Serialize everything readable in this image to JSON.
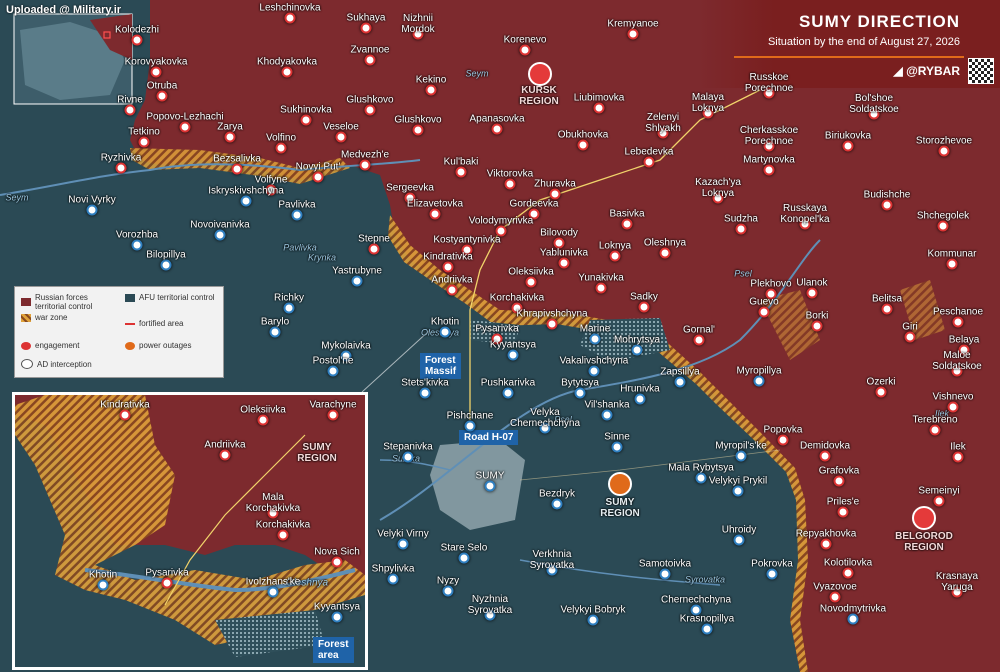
{
  "header": {
    "title": "SUMY DIRECTION",
    "subtitle": "Situation by the end of August 27, 2026",
    "brand": "◢ @RYBAR",
    "watermark": "Uploaded @ Military.ir"
  },
  "colors": {
    "russian": "#7d2a2e",
    "ukraine": "#2b4a55",
    "warzone": "#e0a23a",
    "accent": "#e06a1a",
    "river": "#5f8fb6"
  },
  "legend": {
    "russian_control": "Russian forces territorial control",
    "afu_control": "AFU territorial control",
    "war_zone": "war zone",
    "fortified_area": "fortified area",
    "engagement": "engagement",
    "power_outages": "power outages",
    "ad_interception": "AD interception"
  },
  "regions": {
    "kursk": "KURSK\nREGION",
    "sumy": "SUMY\nREGION",
    "belgorod": "BELGOROD\nREGION",
    "sumy_inset": "SUMY\nREGION"
  },
  "tags": {
    "forest_massif": "Forest\nMassif",
    "road": "Road H-07",
    "forest_area": "Forest\narea"
  },
  "rivers": {
    "seym1": "Seym",
    "seym2": "Seym",
    "pavlivka": "Pavlivka",
    "krynka": "Krynka",
    "psel1": "Psel",
    "psel2": "Psel",
    "sumka": "Sumka",
    "syrovatka": "Syrovatka",
    "ilek": "Ilek",
    "oleshnya": "Oleshnya",
    "oleshnya_inset": "Oleshnya"
  },
  "places": [
    {
      "id": "leshchinovka",
      "name": "Leshchinovka",
      "red": true
    },
    {
      "id": "sukhaya",
      "name": "Sukhaya",
      "red": true
    },
    {
      "id": "nizhnii",
      "name": "Nizhnii\nMordok",
      "red": true
    },
    {
      "id": "korenevo",
      "name": "Korenevo",
      "red": true
    },
    {
      "id": "kremyanoe",
      "name": "Kremyanoe",
      "red": true
    },
    {
      "id": "kolodezhi",
      "name": "Kolodezhi",
      "red": true
    },
    {
      "id": "zvannoe",
      "name": "Zvannoe",
      "red": true
    },
    {
      "id": "korovyakovka",
      "name": "Korovyakovka",
      "red": true
    },
    {
      "id": "khodyakovka",
      "name": "Khodyakovka",
      "red": true
    },
    {
      "id": "kekino",
      "name": "Kekino",
      "red": true
    },
    {
      "id": "russkoe",
      "name": "Russkoe\nPorechnoe",
      "red": true
    },
    {
      "id": "otruba",
      "name": "Otruba",
      "red": true
    },
    {
      "id": "glushkovo",
      "name": "Glushkovo",
      "red": true
    },
    {
      "id": "liubimovka",
      "name": "Liubimovka",
      "red": true
    },
    {
      "id": "malaya",
      "name": "Malaya\nLoknya",
      "red": true
    },
    {
      "id": "bolshoe",
      "name": "Bol'shoe\nSoldatskoe",
      "red": true
    },
    {
      "id": "rivne",
      "name": "Rivne",
      "red": true
    },
    {
      "id": "popovo",
      "name": "Popovo-Lezhachi",
      "red": true
    },
    {
      "id": "sukhinovka",
      "name": "Sukhinovka",
      "red": true
    },
    {
      "id": "apanasovka",
      "name": "Apanasovka",
      "red": true
    },
    {
      "id": "zelenyi",
      "name": "Zelenyi\nShlyakh",
      "red": true
    },
    {
      "id": "cherkasskoe",
      "name": "Cherkasskoe\nPorechnoe",
      "red": true
    },
    {
      "id": "biriukovka",
      "name": "Biriukovka",
      "red": true
    },
    {
      "id": "tetkino",
      "name": "Tetkino",
      "red": true
    },
    {
      "id": "zarya",
      "name": "Zarya",
      "red": true
    },
    {
      "id": "volfino",
      "name": "Volfino",
      "red": true
    },
    {
      "id": "veseloe",
      "name": "Veseloe",
      "red": true
    },
    {
      "id": "glushkovo2",
      "name": "Glushkovo",
      "red": true
    },
    {
      "id": "obukhovka",
      "name": "Obukhovka",
      "red": true
    },
    {
      "id": "storozhevoe",
      "name": "Storozhevoe",
      "red": true
    },
    {
      "id": "medvezhe",
      "name": "Medvezh'e",
      "red": true
    },
    {
      "id": "lebedevka",
      "name": "Lebedevka",
      "red": true
    },
    {
      "id": "martynovka",
      "name": "Martynovka",
      "red": true
    },
    {
      "id": "ryzhivka",
      "name": "Ryzhivka",
      "red": true
    },
    {
      "id": "bezsalivka",
      "name": "Bezsalivka",
      "red": true
    },
    {
      "id": "novyiput",
      "name": "Novyi Put'",
      "red": true
    },
    {
      "id": "kubaki",
      "name": "Kul'baki",
      "red": true
    },
    {
      "id": "volfyne",
      "name": "Volfyne",
      "red": true
    },
    {
      "id": "viktorovka",
      "name": "Viktorovka",
      "red": true
    },
    {
      "id": "kazachya",
      "name": "Kazach'ya\nLoknya",
      "red": true
    },
    {
      "id": "budishche",
      "name": "Budishche",
      "red": true
    },
    {
      "id": "iskryskivshchyna",
      "name": "Iskryskivshchyna",
      "red": false
    },
    {
      "id": "sergeevka",
      "name": "Sergeevka",
      "red": true
    },
    {
      "id": "zhuravka",
      "name": "Zhuravka",
      "red": true
    },
    {
      "id": "russkaya",
      "name": "Russkaya\nKonopel'ka",
      "red": true
    },
    {
      "id": "novivyrky",
      "name": "Novi Vyrky",
      "red": false
    },
    {
      "id": "pavlivka",
      "name": "Pavlivka",
      "red": false
    },
    {
      "id": "elizavetovka",
      "name": "Elizavetovka",
      "red": true
    },
    {
      "id": "gordeevka",
      "name": "Gordeevka",
      "red": true
    },
    {
      "id": "basivka",
      "name": "Basivka",
      "red": true
    },
    {
      "id": "sudzha",
      "name": "Sudzha",
      "red": true
    },
    {
      "id": "shchegolek",
      "name": "Shchegolek",
      "red": true
    },
    {
      "id": "vorozhba",
      "name": "Vorozhba",
      "red": false
    },
    {
      "id": "novoivanivka",
      "name": "Novoivanivka",
      "red": false
    },
    {
      "id": "volodymyrivka",
      "name": "Volodymyrivka",
      "red": true
    },
    {
      "id": "bilovody",
      "name": "Bilovody",
      "red": true
    },
    {
      "id": "stepne",
      "name": "Stepne",
      "red": true
    },
    {
      "id": "kostyantynivka",
      "name": "Kostyantynivka",
      "red": true
    },
    {
      "id": "oleshnya",
      "name": "Oleshnya",
      "red": true
    },
    {
      "id": "bilopillya",
      "name": "Bilopillya",
      "red": false
    },
    {
      "id": "yablunivka",
      "name": "Yablunivka",
      "red": true
    },
    {
      "id": "loknya",
      "name": "Loknya",
      "red": true
    },
    {
      "id": "kommunar",
      "name": "Kommunar",
      "red": true
    },
    {
      "id": "kindrativka",
      "name": "Kindrativka",
      "red": true
    },
    {
      "id": "yastrubyne",
      "name": "Yastrubyne",
      "red": false
    },
    {
      "id": "oleksiivka",
      "name": "Oleksiivka",
      "red": true
    },
    {
      "id": "yunakivka",
      "name": "Yunakivka",
      "red": true
    },
    {
      "id": "plekhovo",
      "name": "Plekhovo",
      "red": true
    },
    {
      "id": "ulanok",
      "name": "Ulanok",
      "red": true
    },
    {
      "id": "andriivka",
      "name": "Andriivka",
      "red": true
    },
    {
      "id": "korchakivka",
      "name": "Korchakivka",
      "red": true
    },
    {
      "id": "sadky",
      "name": "Sadky",
      "red": true
    },
    {
      "id": "guevo",
      "name": "Guevo",
      "red": true
    },
    {
      "id": "belitsa",
      "name": "Belitsa",
      "red": true
    },
    {
      "id": "richky",
      "name": "Richky",
      "red": false
    },
    {
      "id": "khrapivshchyna",
      "name": "Khrapivshchyna",
      "red": true
    },
    {
      "id": "borki",
      "name": "Borki",
      "red": true
    },
    {
      "id": "peschanoe",
      "name": "Peschanoe",
      "red": true
    },
    {
      "id": "barylo",
      "name": "Barylo",
      "red": false
    },
    {
      "id": "khotin",
      "name": "Khotin",
      "red": false
    },
    {
      "id": "pysarivka",
      "name": "Pysarivka",
      "red": true
    },
    {
      "id": "marine",
      "name": "Marine",
      "red": false
    },
    {
      "id": "gornal",
      "name": "Gornal'",
      "red": true
    },
    {
      "id": "giri",
      "name": "Giri",
      "red": true
    },
    {
      "id": "mykolaivka",
      "name": "Mykolaivka",
      "red": false
    },
    {
      "id": "kyyantsya",
      "name": "Kyyantsya",
      "red": false
    },
    {
      "id": "mohrytsya",
      "name": "Mohrytsya",
      "red": false
    },
    {
      "id": "belaya",
      "name": "Belaya",
      "red": true
    },
    {
      "id": "postolne",
      "name": "Postol'ne",
      "red": false
    },
    {
      "id": "vakalivshchyna",
      "name": "Vakalivshchyna",
      "red": false
    },
    {
      "id": "maloe",
      "name": "Maloe\nSoldatskoe",
      "red": true
    },
    {
      "id": "pushkarivka",
      "name": "Pushkarivka",
      "red": false
    },
    {
      "id": "bytytsya",
      "name": "Bytytsya",
      "red": false
    },
    {
      "id": "zapsillya",
      "name": "Zapsillya",
      "red": false
    },
    {
      "id": "myropillya",
      "name": "Myropillya",
      "red": false
    },
    {
      "id": "ozerki",
      "name": "Ozerki",
      "red": true
    },
    {
      "id": "stetskivka",
      "name": "Stets'kivka",
      "red": false
    },
    {
      "id": "hrunivka",
      "name": "Hrunivka",
      "red": false
    },
    {
      "id": "vishnevo",
      "name": "Vishnevo",
      "red": true
    },
    {
      "id": "pishchane",
      "name": "Pishchane",
      "red": false
    },
    {
      "id": "velyka",
      "name": "Velyka\nChernechchyna",
      "red": false
    },
    {
      "id": "vilshanka",
      "name": "Vil'shanka",
      "red": false
    },
    {
      "id": "popovka",
      "name": "Popovka",
      "red": true
    },
    {
      "id": "terebreno",
      "name": "Terebreno",
      "red": true
    },
    {
      "id": "stepanivka",
      "name": "Stepanivka",
      "red": false
    },
    {
      "id": "sinne",
      "name": "Sinne",
      "red": false
    },
    {
      "id": "myropilske",
      "name": "Myropil's'ke",
      "red": false
    },
    {
      "id": "demidovka",
      "name": "Demidovka",
      "red": true
    },
    {
      "id": "ilek",
      "name": "Ilek",
      "red": true
    },
    {
      "id": "sumy",
      "name": "SUMY",
      "red": false
    },
    {
      "id": "malarybytsya",
      "name": "Mala Rybytsya",
      "red": false
    },
    {
      "id": "velykyiprykil",
      "name": "Velykyi Prykil",
      "red": false
    },
    {
      "id": "grafovka",
      "name": "Grafovka",
      "red": true
    },
    {
      "id": "bezdryk",
      "name": "Bezdryk",
      "red": false
    },
    {
      "id": "prilese",
      "name": "Priles'e",
      "red": true
    },
    {
      "id": "semeinyi",
      "name": "Semeinyi",
      "red": true
    },
    {
      "id": "uhroidy",
      "name": "Uhroidy",
      "red": false
    },
    {
      "id": "velykivirny",
      "name": "Velyki Virny",
      "red": false
    },
    {
      "id": "repyakhovka",
      "name": "Repyakhovka",
      "red": true
    },
    {
      "id": "stareselo",
      "name": "Stare Selo",
      "red": false
    },
    {
      "id": "verkhnia",
      "name": "Verkhnia\nSyrovatka",
      "red": false
    },
    {
      "id": "samotoivka",
      "name": "Samotoivka",
      "red": false
    },
    {
      "id": "kolotilovka",
      "name": "Kolotilovka",
      "red": true
    },
    {
      "id": "shpylivka",
      "name": "Shpylivka",
      "red": false
    },
    {
      "id": "pokrovka",
      "name": "Pokrovka",
      "red": false
    },
    {
      "id": "vyazovoe",
      "name": "Vyazovoe",
      "red": true
    },
    {
      "id": "krasnaya",
      "name": "Krasnaya\nYaruga",
      "red": true
    },
    {
      "id": "nyzy",
      "name": "Nyzy",
      "red": false
    },
    {
      "id": "nyzhnia",
      "name": "Nyzhnia\nSyrovatka",
      "red": false
    },
    {
      "id": "chernechchyna",
      "name": "Chernechchyna",
      "red": false
    },
    {
      "id": "velykyibobryk",
      "name": "Velykyi Bobryk",
      "red": false
    },
    {
      "id": "novodmytrivka",
      "name": "Novodmytrivka",
      "red": false
    },
    {
      "id": "krasnopillya",
      "name": "Krasnopillya",
      "red": false
    }
  ],
  "inset_places": [
    {
      "id": "i_kindrativka",
      "name": "Kindrativka",
      "red": true
    },
    {
      "id": "i_oleksiivka",
      "name": "Oleksiivka",
      "red": true
    },
    {
      "id": "i_varachyne",
      "name": "Varachyne",
      "red": true
    },
    {
      "id": "i_andriivka",
      "name": "Andriivka",
      "red": true
    },
    {
      "id": "i_mala",
      "name": "Mala\nKorchakivka",
      "red": true
    },
    {
      "id": "i_korchakivka",
      "name": "Korchakivka",
      "red": true
    },
    {
      "id": "i_novasich",
      "name": "Nova Sich",
      "red": true
    },
    {
      "id": "i_khotin",
      "name": "Khotin",
      "red": false
    },
    {
      "id": "i_pysarivka",
      "name": "Pysarivka",
      "red": true
    },
    {
      "id": "i_ivolzhanske",
      "name": "Ivolzhans'ke",
      "red": false
    },
    {
      "id": "i_kyyantsya",
      "name": "Kyyantsya",
      "red": false
    }
  ]
}
